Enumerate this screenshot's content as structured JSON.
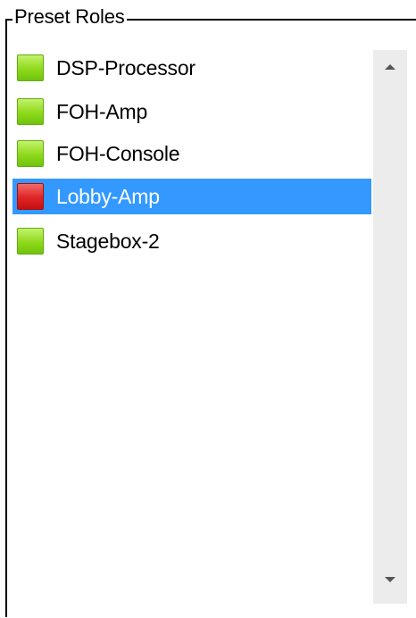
{
  "groupbox": {
    "title": "Preset Roles"
  },
  "list": {
    "items": [
      {
        "label": "DSP-Processor",
        "status": "green",
        "selected": false
      },
      {
        "label": "FOH-Amp",
        "status": "green",
        "selected": false
      },
      {
        "label": "FOH-Console",
        "status": "green",
        "selected": false
      },
      {
        "label": "Lobby-Amp",
        "status": "red",
        "selected": true
      },
      {
        "label": "Stagebox-2",
        "status": "green",
        "selected": false
      }
    ]
  },
  "colors": {
    "selection": "#3399ff",
    "status_green": "#8fd91c",
    "status_red": "#df2525"
  },
  "icons": {
    "scroll_up": "chevron-up-icon",
    "scroll_down": "chevron-down-icon"
  }
}
